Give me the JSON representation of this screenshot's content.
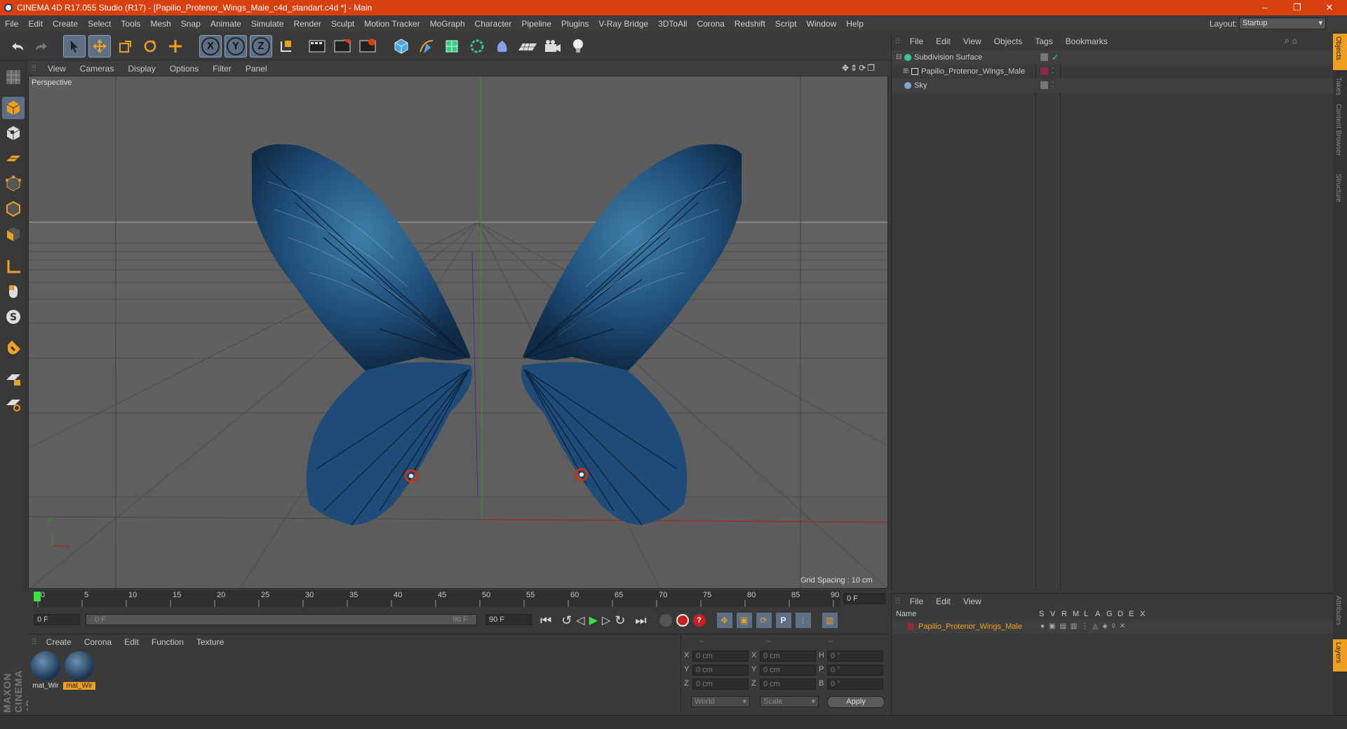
{
  "title": "CINEMA 4D R17.055 Studio (R17) - [Papilio_Protenor_Wings_Male_c4d_standart.c4d *] - Main",
  "window_controls": {
    "minimize": "–",
    "maximize": "❐",
    "close": "✕"
  },
  "menu": [
    "File",
    "Edit",
    "Create",
    "Select",
    "Tools",
    "Mesh",
    "Snap",
    "Animate",
    "Simulate",
    "Render",
    "Sculpt",
    "Motion Tracker",
    "MoGraph",
    "Character",
    "Pipeline",
    "Plugins",
    "V-Ray Bridge",
    "3DToAll",
    "Corona",
    "Redshift",
    "Script",
    "Window",
    "Help"
  ],
  "layout": {
    "label": "Layout:",
    "value": "Startup"
  },
  "toolbar_axes": [
    "X",
    "Y",
    "Z"
  ],
  "viewport": {
    "menu": [
      "View",
      "Cameras",
      "Display",
      "Options",
      "Filter",
      "Panel"
    ],
    "label": "Perspective",
    "grid_spacing": "Grid Spacing : 10 cm",
    "axis_y": "y",
    "axis_x": "x"
  },
  "timeline": {
    "ticks": [
      "0",
      "5",
      "10",
      "15",
      "20",
      "25",
      "30",
      "35",
      "40",
      "45",
      "50",
      "55",
      "60",
      "65",
      "70",
      "75",
      "80",
      "85",
      "90"
    ],
    "current_frame": "0 F",
    "start": "0 F",
    "range_start": "0 F",
    "range_end": "90 F",
    "end": "90 F"
  },
  "materials": {
    "menu": [
      "Create",
      "Corona",
      "Edit",
      "Function",
      "Texture"
    ],
    "items": [
      {
        "name": "mat_Wir",
        "selected": false
      },
      {
        "name": "mat_Wir",
        "selected": true
      }
    ]
  },
  "coords": {
    "headers": [
      "--",
      "--",
      "--"
    ],
    "rows": [
      {
        "a": "X",
        "av": "0 cm",
        "b": "X",
        "bv": "0 cm",
        "c": "H",
        "cv": "0 °"
      },
      {
        "a": "Y",
        "av": "0 cm",
        "b": "Y",
        "bv": "0 cm",
        "c": "P",
        "cv": "0 °"
      },
      {
        "a": "Z",
        "av": "0 cm",
        "b": "Z",
        "bv": "0 cm",
        "c": "B",
        "cv": "0 °"
      }
    ],
    "world": "World",
    "scale": "Scale",
    "apply": "Apply"
  },
  "objects": {
    "menu": [
      "File",
      "Edit",
      "View",
      "Objects",
      "Tags",
      "Bookmarks"
    ],
    "items": [
      {
        "name": "Subdivision Surface"
      },
      {
        "name": "Papilio_Protenor_Wings_Male"
      },
      {
        "name": "Sky"
      }
    ]
  },
  "layers": {
    "menu": [
      "File",
      "Edit",
      "View"
    ],
    "header": "Name",
    "cols": [
      "S",
      "V",
      "R",
      "M",
      "L",
      "A",
      "G",
      "D",
      "E",
      "X"
    ],
    "row": "Papilio_Protenor_Wings_Male"
  },
  "side_tabs_top": [
    "Objects",
    "Takes",
    "Content Browser",
    "Structure"
  ],
  "side_tabs_bottom": [
    "Attributes",
    "Layers"
  ],
  "brand": "MAXON CINEMA 4D",
  "colors": {
    "title_bar": "#d9400f",
    "active_tool": "#5d6f85",
    "wing": "#1f4e7a",
    "accent_orange": "#f0a020"
  }
}
